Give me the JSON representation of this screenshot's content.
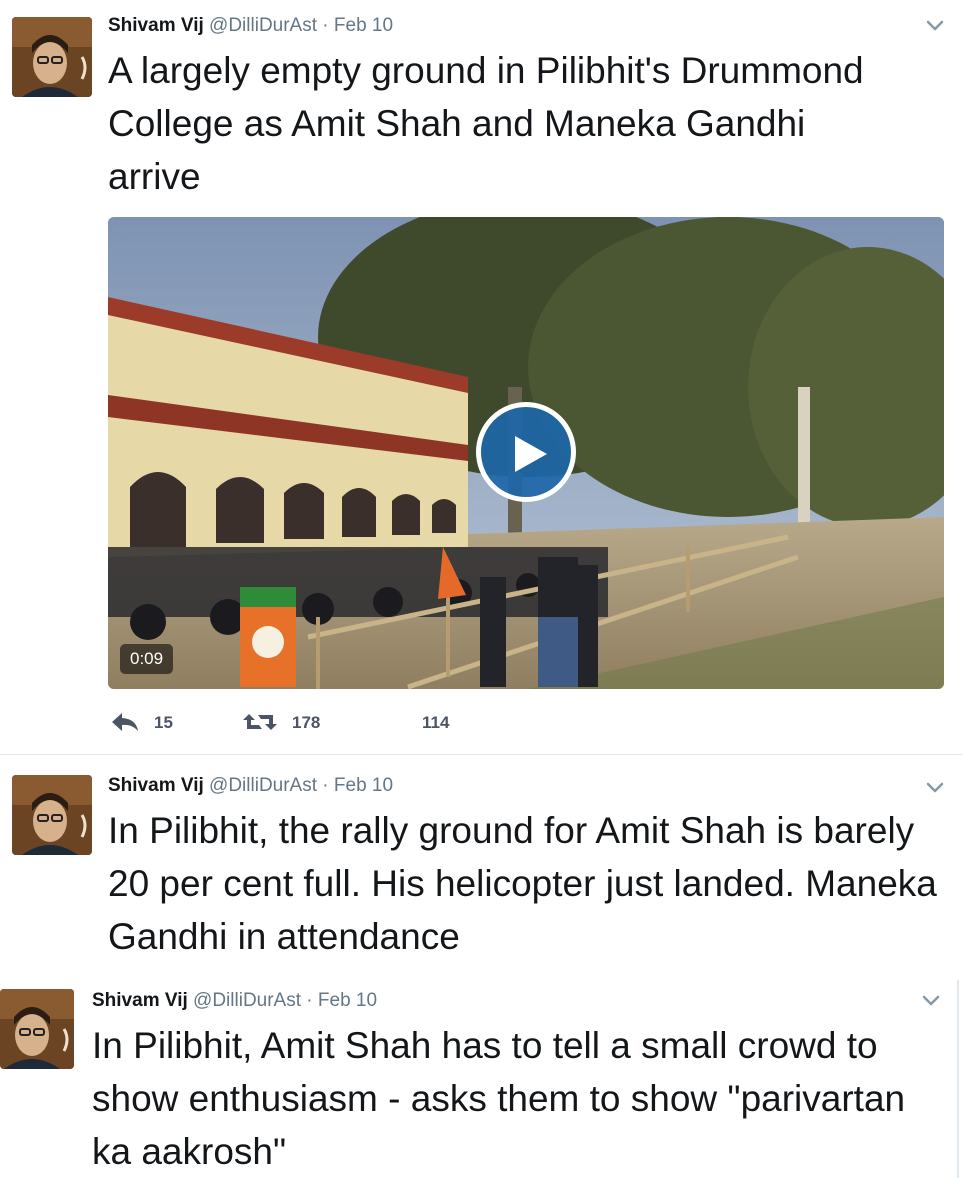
{
  "tweets": [
    {
      "author": "Shivam Vij",
      "handle": "@DilliDurAst",
      "separator": "·",
      "date": "Feb 10",
      "text": "A largely empty ground in Pilibhit's Drummond College as Amit Shah and Maneka Gandhi arrive",
      "media": {
        "duration": "0:09",
        "play_icon": "play-icon"
      },
      "actions": {
        "replies": "15",
        "retweets": "178",
        "likes": "114"
      }
    },
    {
      "author": "Shivam Vij",
      "handle": "@DilliDurAst",
      "separator": "·",
      "date": "Feb 10",
      "text": "In Pilibhit, the rally ground for Amit Shah is barely 20 per cent full. His helicopter just landed. Maneka Gandhi in attendance"
    },
    {
      "author": "Shivam Vij",
      "handle": "@DilliDurAst",
      "separator": "·",
      "date": "Feb 10",
      "text": "In Pilibhit, Amit Shah has to tell a small crowd to show enthusiasm - asks them to show \"parivartan ka aakrosh\""
    }
  ],
  "colors": {
    "text": "#14171a",
    "secondary": "#657786",
    "play_button": "#1d66a8",
    "divider": "#e1e8ed"
  }
}
